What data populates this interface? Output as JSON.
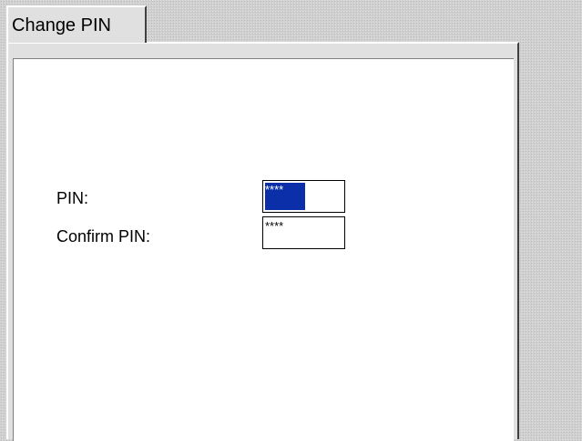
{
  "tab": {
    "label": "Change PIN"
  },
  "form": {
    "pin_label": "PIN:",
    "pin_value": "****",
    "confirm_label": "Confirm PIN:",
    "confirm_value": "****"
  },
  "colors": {
    "selection": "#0b2fa8",
    "content_background": "#ffffff",
    "frame_background": "#e0e0e0"
  }
}
